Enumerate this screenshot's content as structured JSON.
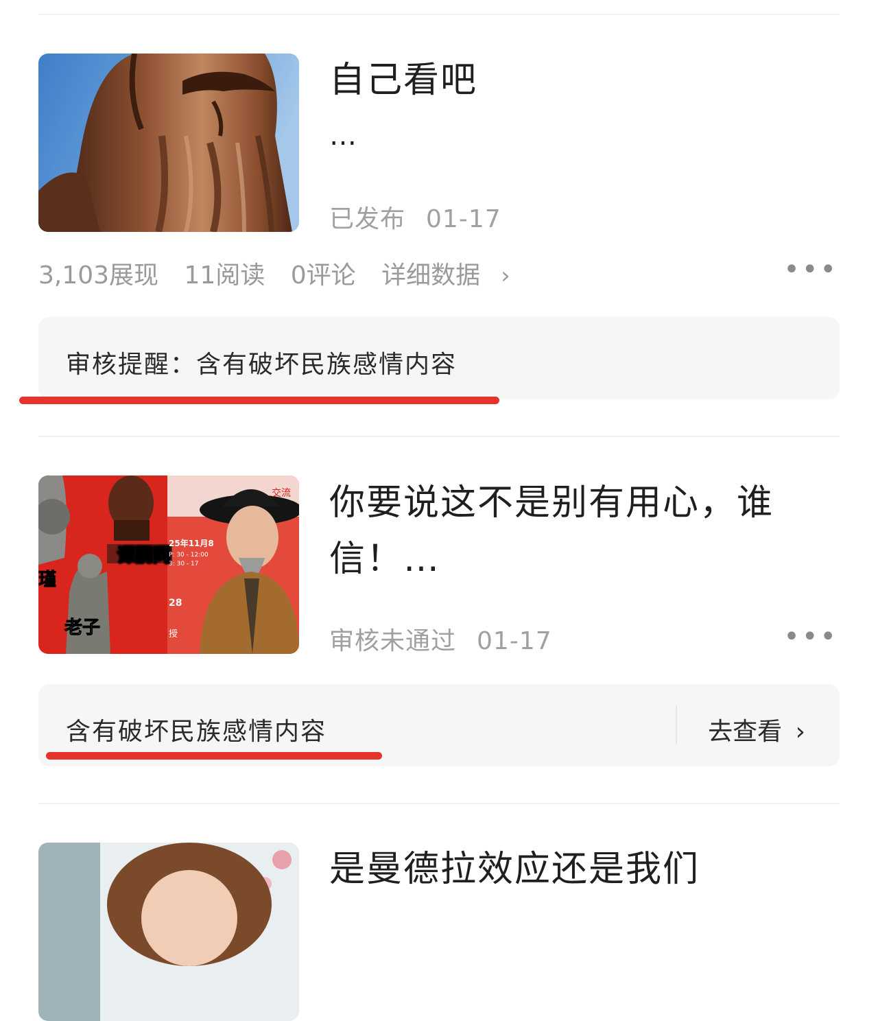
{
  "colors": {
    "accent_red": "#e8332d",
    "notice_bg": "#f6f6f6",
    "muted_text": "#a0a0a0"
  },
  "articles": [
    {
      "title": "自己看吧",
      "ellipsis": "…",
      "status": "已发布",
      "date": "01-17",
      "stats": {
        "impressions": "3,103展现",
        "reads": "11阅读",
        "comments": "0评论",
        "details": "详细数据"
      },
      "notice": "审核提醒：含有破坏民族感情内容",
      "thumbnail": "bronze-statue"
    },
    {
      "title_line1": "你要说这不是别有用心，谁",
      "title_line2": "信！…",
      "status": "审核未通过",
      "date": "01-17",
      "notice": "含有破坏民族感情内容",
      "action": "去查看",
      "thumbnail_labels": {
        "tan": "谭嗣同",
        "laozi": "老子",
        "jin": "瑾",
        "date_line": "25年11月8",
        "time1": "P: 30 - 12:00",
        "time2": "3: 30 - 17",
        "shou": "授",
        "n28": "28",
        "jiaoliu": "交流"
      }
    },
    {
      "title": "是曼德拉效应还是我们",
      "thumbnail": "woman-portrait"
    }
  ],
  "icons": {
    "more": "more-dots-icon",
    "chevron": "chevron-right-icon"
  }
}
